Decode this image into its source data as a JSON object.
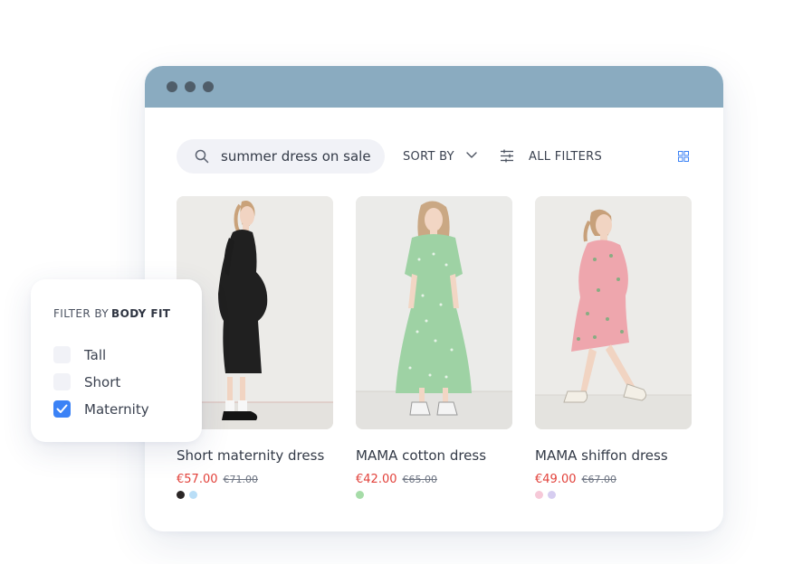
{
  "search": {
    "value": "summer dress on sale"
  },
  "toolbar": {
    "sort_label": "SORT BY",
    "filters_label": "ALL FILTERS"
  },
  "products": [
    {
      "name": "Short maternity dress",
      "price": "€57.00",
      "old_price": "€71.00",
      "swatches": [
        "#2b2626",
        "#b9def7"
      ]
    },
    {
      "name": "MAMA cotton dress",
      "price": "€42.00",
      "old_price": "€65.00",
      "swatches": [
        "#a6dca8"
      ]
    },
    {
      "name": "MAMA shiffon dress",
      "price": "€49.00",
      "old_price": "€67.00",
      "swatches": [
        "#f6c9d8",
        "#d6cdf0"
      ]
    }
  ],
  "filter_panel": {
    "title_prefix": "FILTER BY",
    "title_bold": "BODY FIT",
    "options": [
      {
        "label": "Tall",
        "checked": false
      },
      {
        "label": "Short",
        "checked": false
      },
      {
        "label": "Maternity",
        "checked": true
      }
    ]
  },
  "colors": {
    "titlebar": "#8aabc0",
    "accent": "#3b82f6",
    "sale_price": "#e2413a"
  }
}
